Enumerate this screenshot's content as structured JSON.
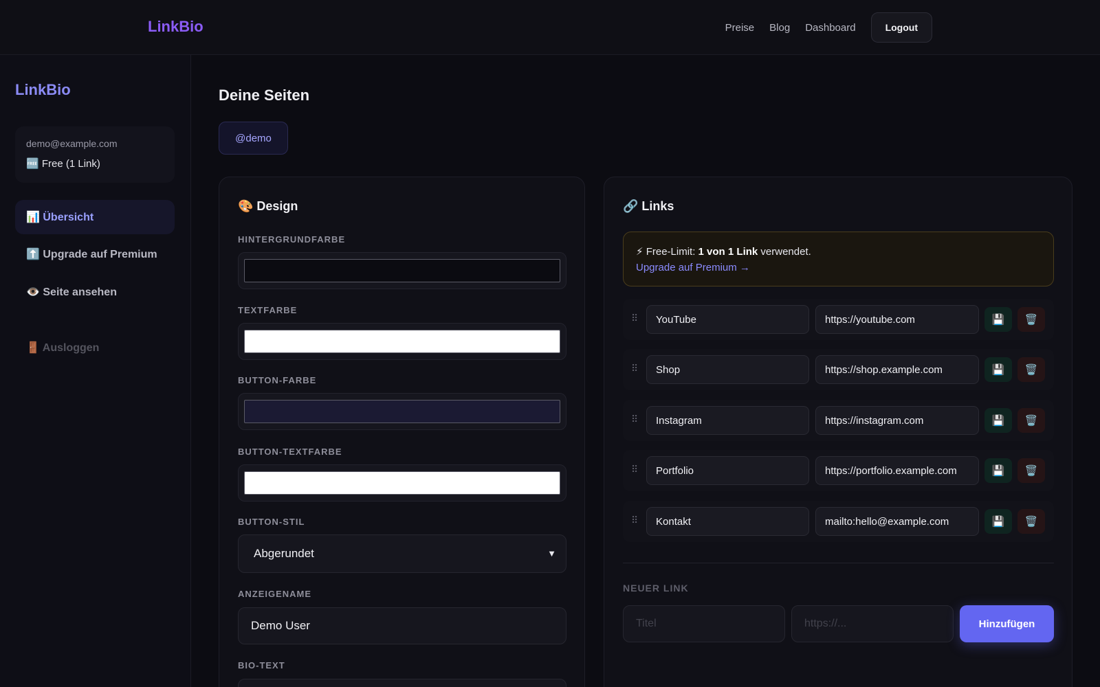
{
  "topbar": {
    "brand": "LinkBio",
    "nav": [
      "Preise",
      "Blog",
      "Dashboard"
    ],
    "logout": "Logout"
  },
  "sidebar": {
    "brand": "LinkBio",
    "email": "demo@example.com",
    "plan": "🆓 Free (1 Link)",
    "items": [
      {
        "label": "📊 Übersicht"
      },
      {
        "label": "⬆️ Upgrade auf Premium"
      },
      {
        "label": "👁️ Seite ansehen"
      },
      {
        "label": "🚪 Ausloggen"
      }
    ]
  },
  "main": {
    "title": "Deine Seiten",
    "page_tab": "@demo"
  },
  "design": {
    "title": "🎨 Design",
    "bg_label": "HINTERGRUNDFARBE",
    "bg_color": "#0b0b11",
    "text_label": "TEXTFARBE",
    "text_color": "#ffffff",
    "button_label": "BUTTON-FARBE",
    "button_color": "#1b1a33",
    "button_text_label": "BUTTON-TEXTFARBE",
    "button_text_color": "#ffffff",
    "style_label": "BUTTON-STIL",
    "style_value": "Abgerundet",
    "name_label": "ANZEIGENAME",
    "name_value": "Demo User",
    "bio_label": "BIO-TEXT"
  },
  "links": {
    "title": "🔗 Links",
    "limit_prefix": "⚡ Free-Limit: ",
    "limit_bold": "1 von 1 Link",
    "limit_suffix": " verwendet.",
    "upgrade_link": "Upgrade auf Premium →",
    "rows": [
      {
        "title": "YouTube",
        "url": "https://youtube.com"
      },
      {
        "title": "Shop",
        "url": "https://shop.example.com"
      },
      {
        "title": "Instagram",
        "url": "https://instagram.com"
      },
      {
        "title": "Portfolio",
        "url": "https://portfolio.example.com"
      },
      {
        "title": "Kontakt",
        "url": "mailto:hello@example.com"
      }
    ],
    "save_icon": "💾",
    "delete_icon": "🗑️",
    "drag_icon": "⠿",
    "new_label": "NEUER LINK",
    "new_title_placeholder": "Titel",
    "new_url_placeholder": "https://...",
    "add_button": "Hinzufügen"
  },
  "colors": {
    "accent": "#6366f1",
    "brand": "#8b5cf6"
  }
}
